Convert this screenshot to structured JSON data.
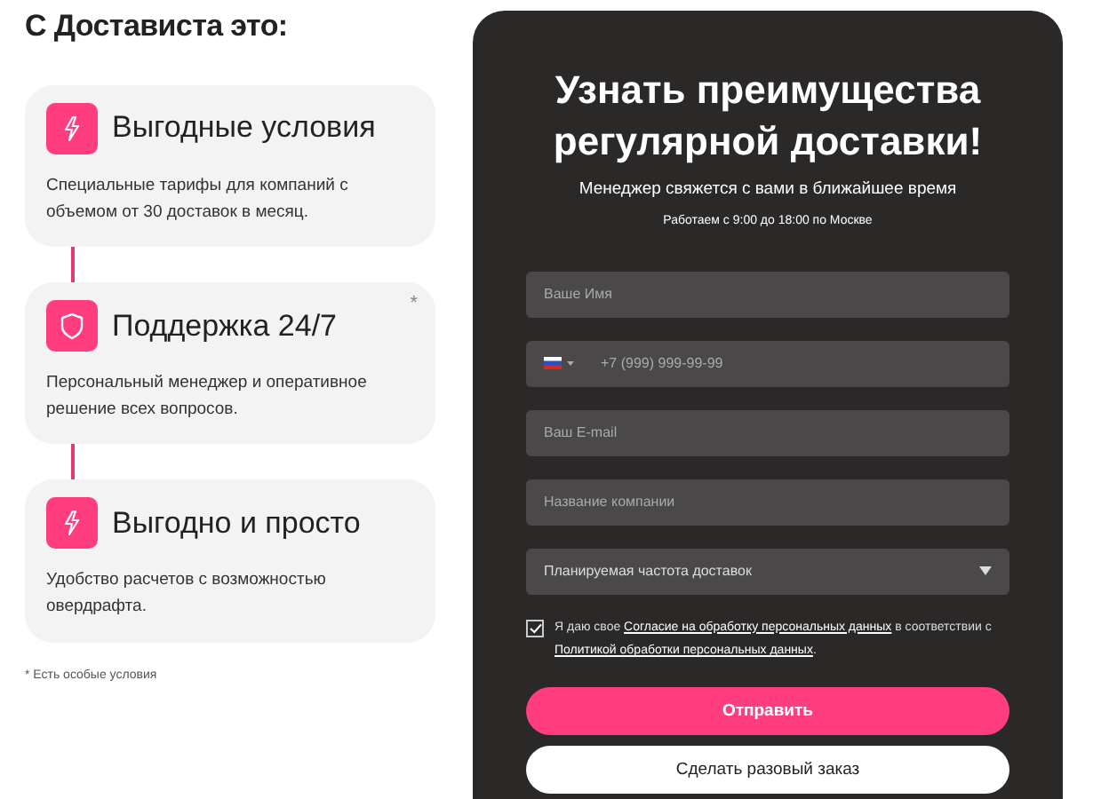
{
  "heading": "С Достависта это:",
  "cards": [
    {
      "kind": "bolt",
      "title": "Выгодные условия",
      "text": "Специальные тарифы для компаний с объемом от 30 доставок в месяц."
    },
    {
      "kind": "shield",
      "title": "Поддержка 24/7",
      "note": "*",
      "text": "Персональный менеджер и оперативное решение всех вопросов."
    },
    {
      "kind": "bolt",
      "title": "Выгодно и просто",
      "text": "Удобство расчетов с возможностью овердрафта."
    }
  ],
  "footnote": "* Есть особые условия",
  "form": {
    "title_lines": [
      "Узнать преимущества",
      "регулярной доставки!"
    ],
    "subtitle": "Менеджер свяжется с вами в ближайшее время",
    "hours": "Работаем с 9:00 до 18:00 по Москве",
    "fields": [
      {
        "kind": "text",
        "placeholder": "Ваше Имя"
      },
      {
        "kind": "phone",
        "placeholder": "+7 (999) 999-99-99"
      },
      {
        "kind": "text",
        "placeholder": "Ваш E-mail"
      },
      {
        "kind": "text",
        "placeholder": "Название компании"
      },
      {
        "kind": "select",
        "value": "Планируемая частота доставок"
      }
    ],
    "consent": {
      "checked": true,
      "parts": [
        {
          "kind": "text",
          "text": "Я даю свое "
        },
        {
          "kind": "link",
          "text": "Согласие на обработку персональных данных"
        },
        {
          "kind": "text",
          "text": " в соответствии с "
        },
        {
          "kind": "link",
          "text": "Политикой обработки персональных данных"
        },
        {
          "kind": "text",
          "text": "."
        }
      ]
    },
    "buttons": [
      {
        "kind": "primary",
        "label": "Отправить"
      },
      {
        "kind": "secondary",
        "label": "Сделать разовый заказ"
      }
    ]
  }
}
